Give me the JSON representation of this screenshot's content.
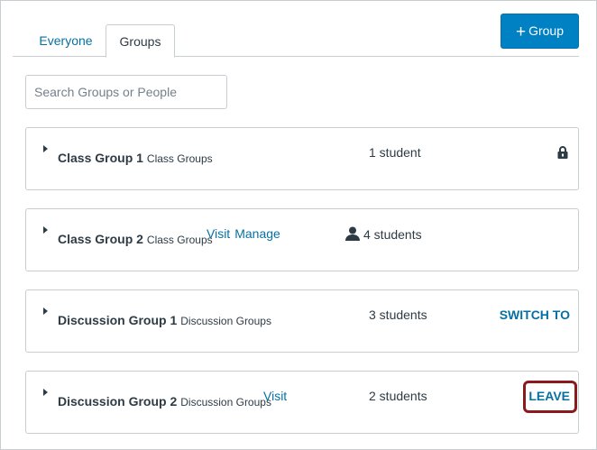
{
  "tabs": [
    {
      "label": "Everyone",
      "active": false
    },
    {
      "label": "Groups",
      "active": true
    }
  ],
  "add_group_button": {
    "label": "Group",
    "color": "#0081c4"
  },
  "search": {
    "placeholder": "Search Groups or People",
    "value": ""
  },
  "colors": {
    "link": "#0770a3",
    "text": "#2d3b45",
    "border": "#c7cdd1",
    "highlight": "#8b1a1f"
  },
  "groups": [
    {
      "name": "Class Group 1",
      "category": "Class Groups",
      "count": "1 student",
      "locked": true,
      "icon": "lock-icon"
    },
    {
      "name": "Class Group 2",
      "category": "Class Groups",
      "links": [
        "Visit",
        "Manage"
      ],
      "count": "4 students",
      "icon": "user-icon"
    },
    {
      "name": "Discussion Group 1",
      "category": "Discussion Groups",
      "count": "3 students",
      "action": "SWITCH TO"
    },
    {
      "name": "Discussion Group 2",
      "category": "Discussion Groups",
      "links": [
        "Visit"
      ],
      "count": "2 students",
      "action": "LEAVE",
      "highlighted": true
    }
  ]
}
